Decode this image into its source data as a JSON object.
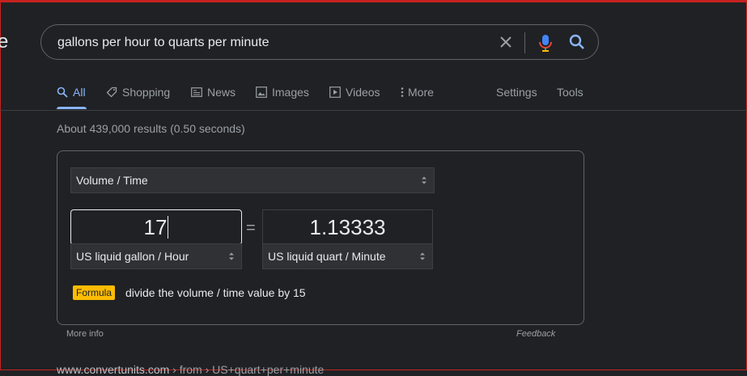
{
  "search": {
    "query": "gallons per hour to quarts per minute"
  },
  "tabs": [
    {
      "label": "All",
      "icon": "search-icon"
    },
    {
      "label": "Shopping",
      "icon": "tag-icon"
    },
    {
      "label": "News",
      "icon": "news-icon"
    },
    {
      "label": "Images",
      "icon": "image-icon"
    },
    {
      "label": "Videos",
      "icon": "video-icon"
    },
    {
      "label": "More",
      "icon": "more-vert-icon"
    }
  ],
  "tools": {
    "settings": "Settings",
    "tools": "Tools"
  },
  "result_stats": "About 439,000 results (0.50 seconds)",
  "converter": {
    "quantity": "Volume / Time",
    "from_value": "17",
    "from_unit": "US liquid gallon / Hour",
    "equals": "=",
    "to_value": "1.13333",
    "to_unit": "US liquid quart / Minute",
    "formula_label": "Formula",
    "formula_text": "divide the volume / time value by 15"
  },
  "footer": {
    "more_info": "More info",
    "feedback": "Feedback"
  },
  "next_result": {
    "site": "www.convertunits.com",
    "path": "› from › US+quart+per+minute"
  },
  "colors": {
    "background": "#202124",
    "accent": "#8ab4f8",
    "badge": "#fbbc04",
    "border": "#5f6368"
  }
}
